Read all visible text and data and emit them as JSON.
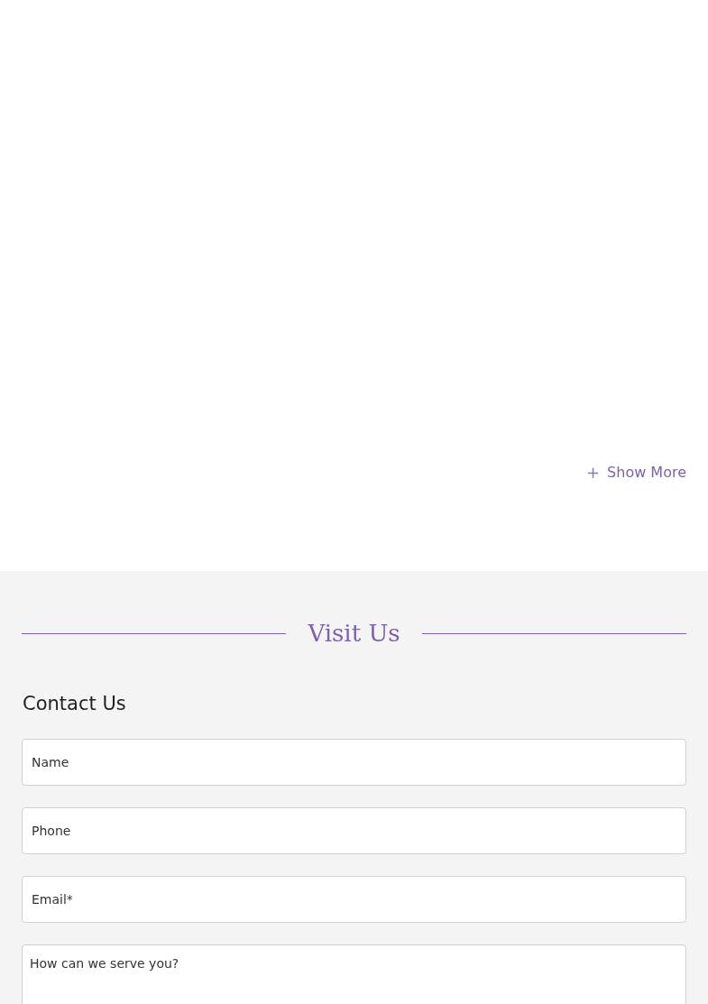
{
  "show_more": {
    "icon": "+",
    "label": "Show More"
  },
  "visit": {
    "title": "Visit Us"
  },
  "contact": {
    "title": "Contact Us",
    "fields": [
      {
        "kind": "input",
        "placeholder": "Name"
      },
      {
        "kind": "input",
        "placeholder": "Phone"
      },
      {
        "kind": "input",
        "placeholder": "Email*"
      },
      {
        "kind": "textarea",
        "placeholder": "How can we serve you?"
      }
    ]
  }
}
